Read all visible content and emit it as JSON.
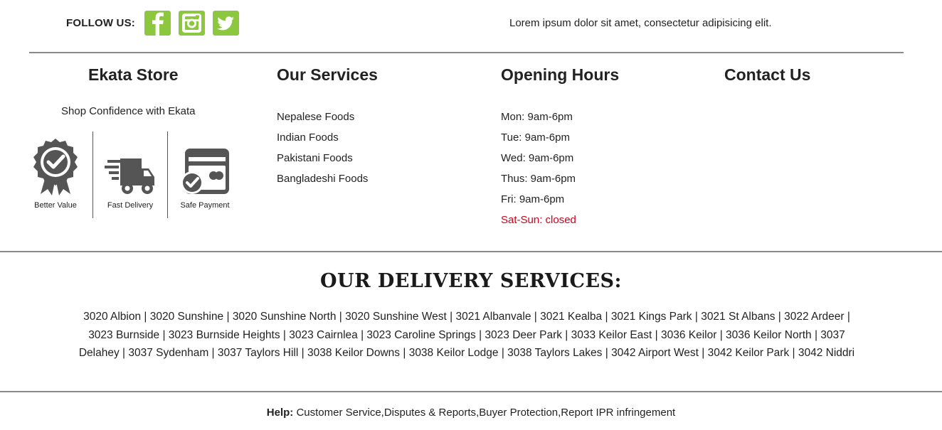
{
  "follow": {
    "label": "FOLLOW US:",
    "icons": [
      "facebook-icon",
      "instagram-icon",
      "twitter-icon"
    ],
    "accent": "#8dc63f"
  },
  "tagline": "Lorem ipsum dolor sit amet, consectetur adipisicing elit.",
  "store": {
    "title": "Ekata Store",
    "subtitle": "Shop Confidence with Ekata",
    "features": [
      {
        "icon": "badge-check-icon",
        "label": "Better Value"
      },
      {
        "icon": "delivery-truck-icon",
        "label": "Fast Delivery"
      },
      {
        "icon": "card-check-icon",
        "label": "Safe Payment"
      }
    ]
  },
  "services": {
    "title": "Our Services",
    "items": [
      "Nepalese Foods",
      "Indian Foods",
      "Pakistani Foods",
      "Bangladeshi Foods"
    ]
  },
  "hours": {
    "title": "Opening Hours",
    "items": [
      "Mon: 9am-6pm",
      "Tue: 9am-6pm",
      "Wed: 9am-6pm",
      "Thus: 9am-6pm",
      "Fri: 9am-6pm"
    ],
    "closed": "Sat-Sun: closed",
    "closed_color": "#d0021b"
  },
  "contact": {
    "title": "Contact Us"
  },
  "delivery": {
    "title": "OUR DELIVERY SERVICES:",
    "areas": "3020 Albion | 3020 Sunshine | 3020 Sunshine North | 3020 Sunshine West | 3021 Albanvale | 3021 Kealba | 3021 Kings Park | 3021 St Albans | 3022 Ardeer | 3023 Burnside | 3023 Burnside Heights | 3023 Cairnlea | 3023 Caroline Springs | 3023 Deer Park | 3033 Keilor East | 3036 Keilor | 3036 Keilor North | 3037 Delahey | 3037 Sydenham | 3037 Taylors Hill | 3038 Keilor Downs | 3038 Keilor Lodge | 3038 Taylors Lakes | 3042 Airport West | 3042 Keilor Park | 3042 Niddri"
  },
  "help": {
    "label": "Help:",
    "links": [
      "Customer Service",
      "Disputes & Reports",
      "Buyer Protection",
      "Report IPR infringement"
    ]
  }
}
